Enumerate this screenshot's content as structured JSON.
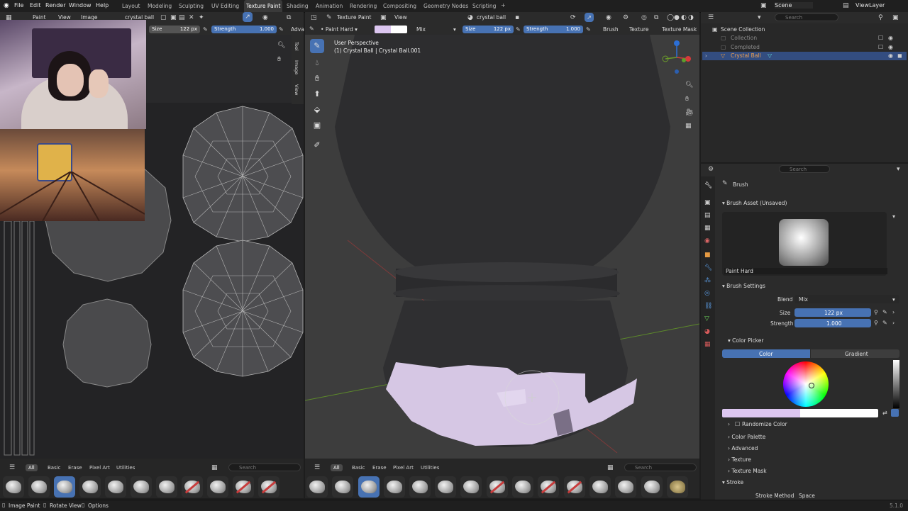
{
  "menu": [
    "File",
    "Edit",
    "Render",
    "Window",
    "Help"
  ],
  "workspaces": [
    "Layout",
    "Modeling",
    "Sculpting",
    "UV Editing",
    "Texture Paint",
    "Shading",
    "Animation",
    "Rendering",
    "Compositing",
    "Geometry Nodes",
    "Scripting"
  ],
  "active_workspace": "Texture Paint",
  "scene_label": "Scene",
  "viewlayer_label": "ViewLayer",
  "image_editor": {
    "mode": "Paint",
    "view_menu": "View",
    "image_menu": "Image",
    "image_name": "crystal ball",
    "size_label": "Size",
    "size_value": "122 px",
    "strength_label": "Strength",
    "strength_value": "1.000",
    "adva": "Adva",
    "side_tabs": [
      "Tool",
      "Image",
      "View"
    ]
  },
  "viewport": {
    "mode": "Texture Paint",
    "view_menu": "View",
    "object": "crystal ball",
    "brush_name": "Paint Hard",
    "blend": "Mix",
    "size_label": "Size",
    "size_value": "122 px",
    "strength_label": "Strength",
    "strength_value": "1.000",
    "menus": [
      "Brush",
      "Texture",
      "Texture Mask"
    ],
    "perspective": "User Perspective",
    "object_info": "(1) Crystal Ball | Crystal Ball.001"
  },
  "outliner": {
    "search_placeholder": "Search",
    "root": "Scene Collection",
    "items": [
      "Collection",
      "Completed",
      "Crystal Ball"
    ]
  },
  "properties": {
    "search_placeholder": "Search",
    "section_title": "Brush",
    "brush_asset_header": "Brush Asset (Unsaved)",
    "brush_asset_name": "Paint Hard",
    "brush_settings_header": "Brush Settings",
    "blend_label": "Blend",
    "blend_value": "Mix",
    "size_label": "Size",
    "size_value": "122 px",
    "strength_label": "Strength",
    "strength_value": "1.000",
    "color_picker_header": "Color Picker",
    "tab_color": "Color",
    "tab_gradient": "Gradient",
    "randomize": "Randomize Color",
    "collapsed": [
      "Color Palette",
      "Advanced",
      "Texture",
      "Texture Mask"
    ],
    "stroke_header": "Stroke",
    "stroke_method_label": "Stroke Method",
    "stroke_method_value": "Space"
  },
  "brush_color": "#dcc6f0",
  "accent": "#4772b3",
  "shelf": {
    "tabs": [
      "All",
      "Basic",
      "Erase",
      "Pixel Art",
      "Utilities"
    ],
    "search_placeholder": "Search"
  },
  "status": {
    "items": [
      "Image Paint",
      "Rotate View",
      "Options"
    ],
    "version": "5.1.0"
  }
}
